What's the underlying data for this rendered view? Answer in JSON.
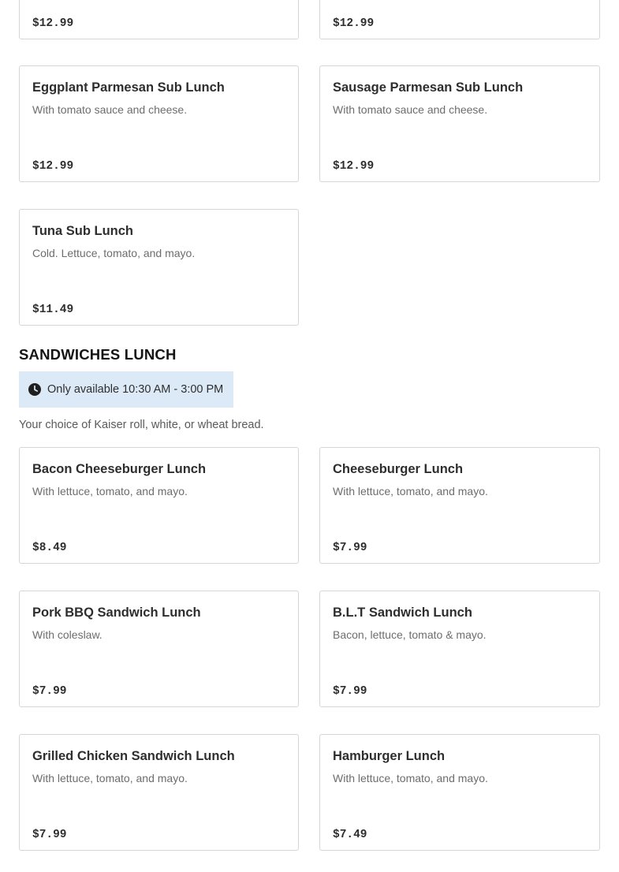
{
  "top_cards": [
    {
      "price": "$12.99"
    },
    {
      "price": "$12.99"
    }
  ],
  "subs_items": [
    {
      "name": "Eggplant Parmesan Sub Lunch",
      "description": "With tomato sauce and cheese.",
      "price": "$12.99"
    },
    {
      "name": "Sausage Parmesan Sub Lunch",
      "description": "With tomato sauce and cheese.",
      "price": "$12.99"
    },
    {
      "name": "Tuna Sub Lunch",
      "description": "Cold. Lettuce, tomato, and mayo.",
      "price": "$11.49"
    }
  ],
  "sandwiches_section": {
    "title": "SANDWICHES LUNCH",
    "availability": "Only available 10:30 AM - 3:00 PM",
    "availability_icon": "clock-icon",
    "description": "Your choice of Kaiser roll, white, or wheat bread.",
    "items": [
      {
        "name": "Bacon Cheeseburger Lunch",
        "description": "With lettuce, tomato, and mayo.",
        "price": "$8.49"
      },
      {
        "name": "Cheeseburger Lunch",
        "description": "With lettuce, tomato, and mayo.",
        "price": "$7.99"
      },
      {
        "name": "Pork BBQ Sandwich Lunch",
        "description": "With coleslaw.",
        "price": "$7.99"
      },
      {
        "name": "B.L.T Sandwich Lunch",
        "description": "Bacon, lettuce, tomato & mayo.",
        "price": "$7.99"
      },
      {
        "name": "Grilled Chicken Sandwich Lunch",
        "description": "With lettuce, tomato, and mayo.",
        "price": "$7.99"
      },
      {
        "name": "Hamburger Lunch",
        "description": "With lettuce, tomato, and mayo.",
        "price": "$7.49"
      }
    ]
  },
  "colors": {
    "availability_bg": "#dceaf8",
    "card_border": "#d6d6d6"
  }
}
